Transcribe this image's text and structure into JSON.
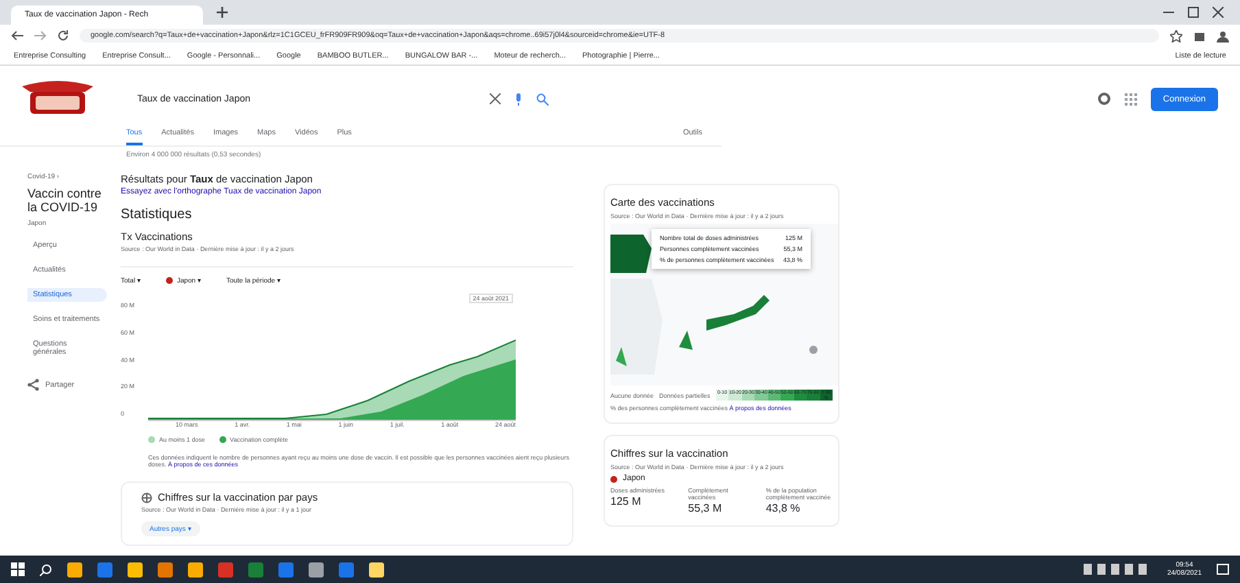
{
  "browser": {
    "tabs": [
      {
        "label": "Taux de vaccination Japon - Rech",
        "selected": true
      }
    ],
    "url": "google.com/search?q=Taux+de+vaccination+Japon&rlz=1C1GCEU_frFR909FR909&oq=Taux+de+vaccination+Japon&aqs=chrome..69i57j0l4&sourceid=chrome&ie=UTF-8",
    "bookmarks": [
      "Entreprise Consulting",
      "Entreprise Consult...",
      "Google - Personnali...",
      "Google",
      "BAMBOO BUTLER...",
      "BUNGALOW BAR -...",
      "Moteur de recherch...",
      "Photographie | Pierre..."
    ],
    "reading_list": "Liste de lecture"
  },
  "search": {
    "value": "Taux de vaccination Japon",
    "sign_in": "Connexion",
    "tabs": [
      {
        "label": "Tous",
        "selected": true
      },
      {
        "label": "Actualités",
        "selected": false
      },
      {
        "label": "Images",
        "selected": false
      },
      {
        "label": "Maps",
        "selected": false
      },
      {
        "label": "Vidéos",
        "selected": false
      },
      {
        "label": "Plus",
        "selected": false
      }
    ],
    "tools": "Outils",
    "result_count": "Environ 4 000 000 résultats (0,53 secondes)"
  },
  "sidebar": {
    "crumb": "Covid-19 ›",
    "title": "Vaccin contre la COVID-19",
    "subtitle": "Japon",
    "items": [
      {
        "label": "Aperçu",
        "selected": false
      },
      {
        "label": "Actualités",
        "selected": false
      },
      {
        "label": "Statistiques",
        "selected": true
      },
      {
        "label": "Soins et traitements",
        "selected": false
      },
      {
        "label": "Questions générales",
        "selected": false
      }
    ],
    "share": "Partager"
  },
  "main": {
    "spelling": "Résultats pour **Taux** de vaccination Japon",
    "spelling_alt": "Essayez avec l'orthographe Tuax de vaccination Japon",
    "heading": "Statistiques",
    "chart_title": "Tx Vaccinations",
    "source": "Source : Our World in Data · Dernière mise à jour : il y a 2 jours",
    "filters": [
      {
        "label": "Total ▾"
      },
      {
        "label": "Japon ▾",
        "color": "#c5221f"
      },
      {
        "label": "Toute la période ▾"
      }
    ],
    "y_ticks": [
      "80 M",
      "60 M",
      "40 M",
      "20 M",
      "0"
    ],
    "x_ticks": [
      "10 mars",
      "1 avr.",
      "1 mai",
      "1 juin",
      "1 juil.",
      "1 août",
      "24 août"
    ],
    "marker": "24 août 2021",
    "legend": [
      {
        "label": "Au moins 1 dose",
        "color": "#a8dab5"
      },
      {
        "label": "Vaccination complète",
        "color": "#34a853"
      }
    ],
    "note": "Ces données indiquent le nombre de personnes ayant reçu au moins une dose de vaccin. Il est possible que les personnes vaccinées aient reçu plusieurs doses.",
    "note_link": "À propos de ces données",
    "card_title": "Chiffres sur la vaccination par pays",
    "card_source": "Source : Our World in Data · Dernière mise à jour : il y a 1 jour",
    "card_button": "Autres pays ▾"
  },
  "map_card": {
    "title": "Carte des vaccinations",
    "source": "Source : Our World in Data · Dernière mise à jour : il y a 2 jours",
    "tooltip": [
      {
        "label": "Nombre total de doses administrées",
        "value": "125 M"
      },
      {
        "label": "Personnes complètement vaccinées",
        "value": "55,3 M"
      },
      {
        "label": "% de personnes complètement vaccinées",
        "value": "43,8 %"
      }
    ],
    "legend": [
      "Aucune donnée",
      "Données partielles"
    ],
    "scale": [
      "0-10",
      "10-20",
      "20-30",
      "30-40",
      "40-50",
      "50-60",
      "60-70",
      "70-80",
      "> 80 %"
    ],
    "caption": "% des personnes complètement vaccinées",
    "caption_link": "À propos des données"
  },
  "stats_card": {
    "title": "Chiffres sur la vaccination",
    "source": "Source : Our World in Data · Dernière mise à jour : il y a 2 jours",
    "country": "Japon",
    "stats": [
      {
        "label": "Doses administrées",
        "value": "125 M"
      },
      {
        "label": "Complètement vaccinées",
        "value": "55,3 M"
      },
      {
        "label": "% de la population complètement vaccinée",
        "value": "43,8 %"
      }
    ]
  },
  "taskbar": {
    "time": "09:54",
    "date": "24/08/2021"
  }
}
